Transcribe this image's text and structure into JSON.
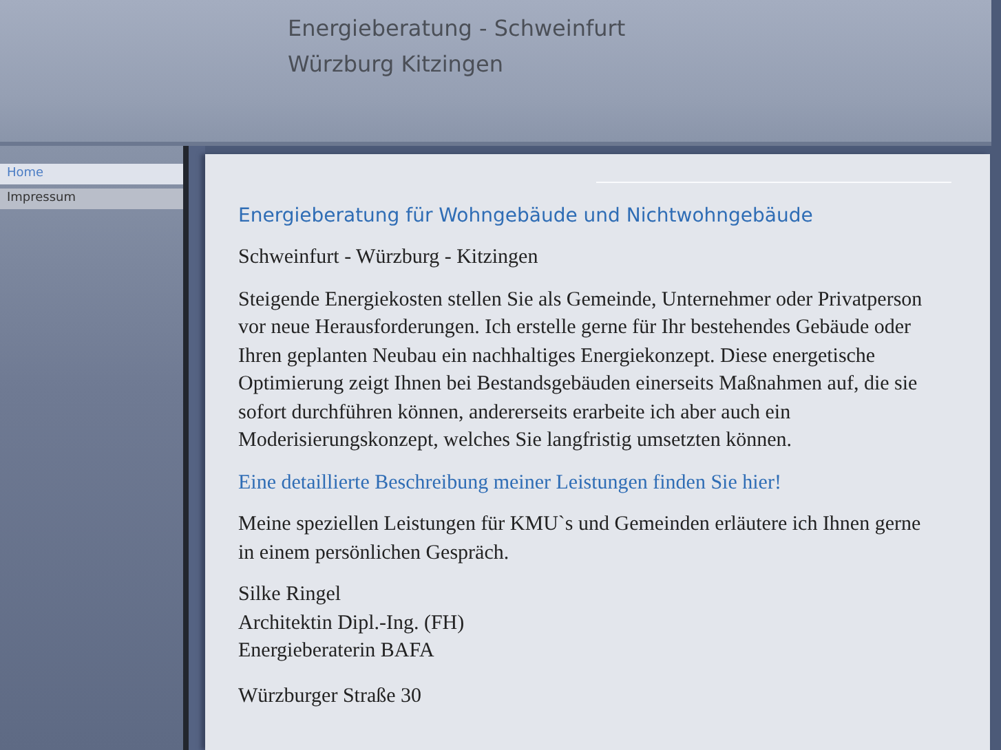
{
  "header": {
    "title_lines": [
      "Energieberatung - Schweinfurt",
      "Würzburg Kitzingen"
    ]
  },
  "nav": [
    {
      "label": "Home",
      "selected": true
    },
    {
      "label": "Impressum",
      "selected": false
    }
  ],
  "content": {
    "heading": "Energieberatung für Wohngebäude und Nichtwohngebäude",
    "subheading": "Schweinfurt - Würzburg - Kitzingen",
    "intro": "Steigende Energiekosten stellen Sie als Gemeinde, Unternehmer oder Privatperson vor neue Herausforderungen. Ich erstelle gerne für Ihr bestehendes Gebäude oder Ihren geplanten Neubau ein nachhaltiges Energiekonzept. Diese energetische Optimierung zeigt Ihnen bei Bestandsgebäuden einerseits Maßnahmen auf, die sie sofort durchführen können, andererseits erarbeite ich aber auch ein  Moderisierungskonzept, welches Sie langfristig umsetzten können.",
    "link": "Eine detaillierte Beschreibung meiner Leistungen finden Sie hier!",
    "paragraph": "Meine speziellen Leistungen für KMU`s und Gemeinden erläutere ich Ihnen gerne in einem persönlichen Gespräch.",
    "signature_lines": [
      "Silke Ringel",
      "Architektin Dipl.-Ing. (FH)",
      "Energieberaterin BAFA"
    ],
    "address_lines": [
      "Würzburger Straße 30"
    ]
  }
}
